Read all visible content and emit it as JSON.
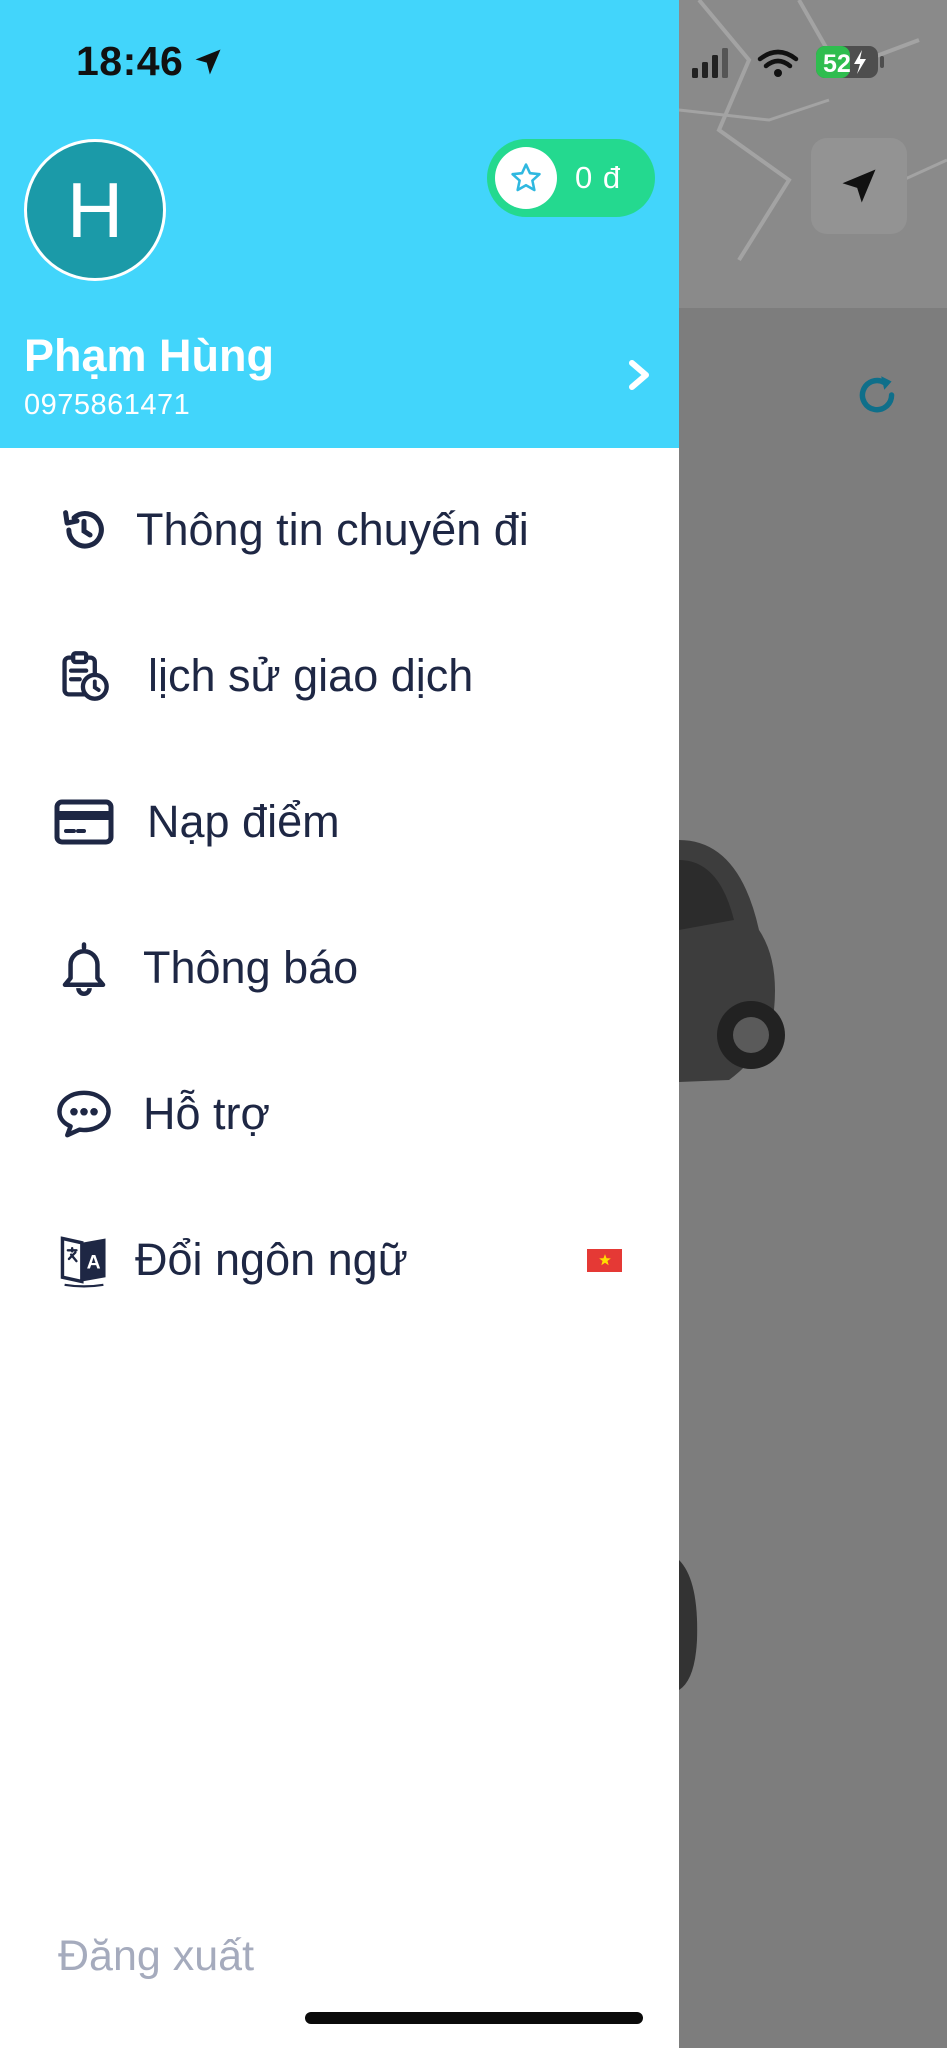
{
  "status_bar": {
    "time": "18:46",
    "battery": "52"
  },
  "profile": {
    "avatar_initial": "H",
    "name": "Phạm Hùng",
    "phone": "0975861471",
    "points": "0 đ"
  },
  "menu": {
    "items": [
      {
        "label": "Thông tin chuyến đi",
        "icon": "history-icon"
      },
      {
        "label": "lịch sử giao dịch",
        "icon": "clipboard-clock-icon"
      },
      {
        "label": "Nạp điểm",
        "icon": "credit-card-icon"
      },
      {
        "label": "Thông báo",
        "icon": "bell-icon"
      },
      {
        "label": "Hỗ trợ",
        "icon": "chat-bubble-icon"
      },
      {
        "label": "Đổi ngôn ngữ",
        "icon": "translate-icon",
        "flag": "vietnam-flag"
      }
    ],
    "logout_label": "Đăng xuất"
  },
  "colors": {
    "header": "#42d5fb",
    "points_pill": "#24d98f",
    "avatar": "#1b9aa8",
    "menu_text": "#1e2744",
    "logout_text": "#a5abbd",
    "overlay": "#7b7b7b"
  }
}
